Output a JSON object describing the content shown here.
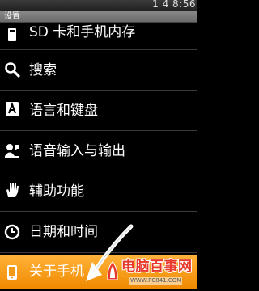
{
  "status_bar": {
    "time": "1 4 8:56"
  },
  "title_bar": {
    "title": "设置"
  },
  "settings": {
    "storage_label": "SD 卡和手机内存",
    "search_label": "搜索",
    "language_label": "语言和键盘",
    "voice_label": "语音输入与输出",
    "accessibility_label": "辅助功能",
    "datetime_label": "日期和时间",
    "about_label": "关于手机"
  },
  "icons": {
    "storage": "storage-icon",
    "search": "search-icon",
    "language": "keyboard-a-icon",
    "voice": "speech-icon",
    "accessibility": "hand-icon",
    "datetime": "clock-icon",
    "about": "phone-info-icon"
  },
  "colors": {
    "selected_row": "#f39a12",
    "watermark_red": "#e8392c"
  },
  "watermark": {
    "title": "电脑百事网",
    "url": "WWW.PC841.COM"
  }
}
